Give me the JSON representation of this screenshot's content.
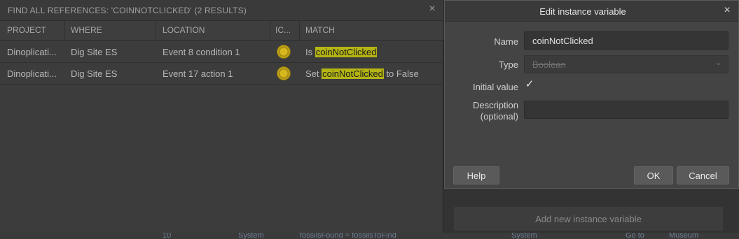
{
  "references_panel": {
    "title": "FIND ALL REFERENCES: 'COINNOTCLICKED' (2 RESULTS)",
    "close_icon": "×",
    "columns": [
      "PROJECT",
      "WHERE",
      "LOCATION",
      "IC...",
      "MATCH"
    ],
    "rows": [
      {
        "project": "Dinoplicati...",
        "where": "Dig Site ES",
        "location": "Event 8 condition 1",
        "icon": "coin-icon",
        "match_prefix": "Is ",
        "match_highlight": "coinNotClicked",
        "match_suffix": ""
      },
      {
        "project": "Dinoplicati...",
        "where": "Dig Site ES",
        "location": "Event 17 action 1",
        "icon": "coin-icon",
        "match_prefix": "Set ",
        "match_highlight": "coinNotClicked",
        "match_suffix": " to False"
      }
    ]
  },
  "dialog": {
    "title": "Edit instance variable",
    "close_icon": "×",
    "name_label": "Name",
    "name_value": "coinNotClicked",
    "type_label": "Type",
    "type_value": "Boolean",
    "initial_label": "Initial value",
    "initial_checked": true,
    "description_label_1": "Description",
    "description_label_2": "(optional)",
    "description_value": "",
    "help_button": "Help",
    "ok_button": "OK",
    "cancel_button": "Cancel"
  },
  "background": {
    "add_var_button": "Add new instance variable",
    "bottom_fragments": [
      "10",
      "System",
      "fossilsFound = fossilsToFind",
      "System",
      "Go to",
      "Museum"
    ]
  },
  "colors": {
    "highlight": "#b4b414",
    "panel_bg": "#3c3c3c",
    "dialog_bg": "#444444"
  }
}
